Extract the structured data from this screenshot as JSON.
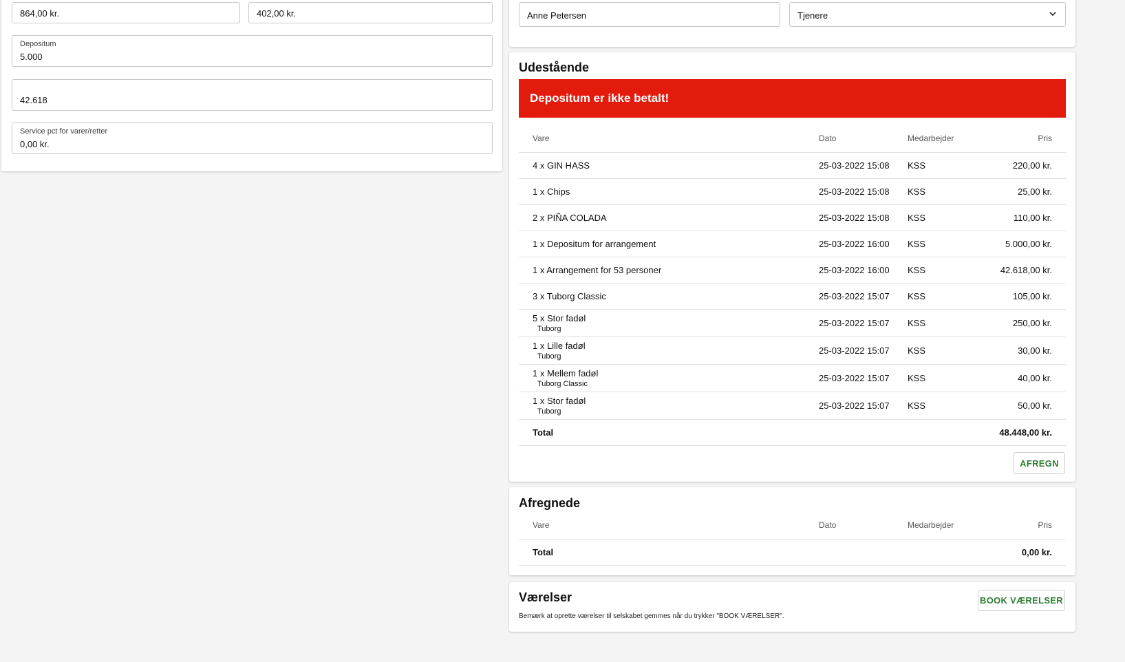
{
  "left_panel": {
    "field_a_value": "864,00 kr.",
    "field_b_value": "402,00 kr.",
    "depositum": {
      "label": "Depositum",
      "value": "5.000"
    },
    "amount_field": {
      "label": "",
      "value": "42.618"
    },
    "service_pct": {
      "label": "Service pct for varer/retter",
      "value": "0,00 kr."
    }
  },
  "top_right": {
    "name_value": "Anne Petersen",
    "role_select": "Tjenere"
  },
  "udestaaende": {
    "title": "Udestående",
    "alert": "Depositum er ikke betalt!",
    "columns": {
      "vare": "Vare",
      "dato": "Dato",
      "medarbejder": "Medarbejder",
      "pris": "Pris"
    },
    "rows": [
      {
        "vare": "4 x GIN HASS",
        "sub": "",
        "dato": "25-03-2022 15:08",
        "medarbejder": "KSS",
        "pris": "220,00 kr."
      },
      {
        "vare": "1 x Chips",
        "sub": "",
        "dato": "25-03-2022 15:08",
        "medarbejder": "KSS",
        "pris": "25,00 kr."
      },
      {
        "vare": "2 x PIÑA COLADA",
        "sub": "",
        "dato": "25-03-2022 15:08",
        "medarbejder": "KSS",
        "pris": "110,00 kr."
      },
      {
        "vare": "1 x Depositum for arrangement",
        "sub": "",
        "dato": "25-03-2022 16:00",
        "medarbejder": "KSS",
        "pris": "5.000,00 kr."
      },
      {
        "vare": "1 x Arrangement for 53 personer",
        "sub": "",
        "dato": "25-03-2022 16:00",
        "medarbejder": "KSS",
        "pris": "42.618,00 kr."
      },
      {
        "vare": "3 x Tuborg Classic",
        "sub": "",
        "dato": "25-03-2022 15:07",
        "medarbejder": "KSS",
        "pris": "105,00 kr."
      },
      {
        "vare": "5 x Stor fadøl",
        "sub": "Tuborg",
        "dato": "25-03-2022 15:07",
        "medarbejder": "KSS",
        "pris": "250,00 kr."
      },
      {
        "vare": "1 x Lille fadøl",
        "sub": "Tuborg",
        "dato": "25-03-2022 15:07",
        "medarbejder": "KSS",
        "pris": "30,00 kr."
      },
      {
        "vare": "1 x Mellem fadøl",
        "sub": "Tuborg Classic",
        "dato": "25-03-2022 15:07",
        "medarbejder": "KSS",
        "pris": "40,00 kr."
      },
      {
        "vare": "1 x Stor fadøl",
        "sub": "Tuborg",
        "dato": "25-03-2022 15:07",
        "medarbejder": "KSS",
        "pris": "50,00 kr."
      }
    ],
    "total_label": "Total",
    "total_value": "48.448,00 kr.",
    "afregn_button": "AFREGN"
  },
  "afregnede": {
    "title": "Afregnede",
    "columns": {
      "vare": "Vare",
      "dato": "Dato",
      "medarbejder": "Medarbejder",
      "pris": "Pris"
    },
    "total_label": "Total",
    "total_value": "0,00 kr."
  },
  "vaerelser": {
    "title": "Værelser",
    "note": "Bemærk at oprette værelser til selskabet gemmes når du trykker \"BOOK VÆRELSER\".",
    "book_button": "BOOK VÆRELSER"
  },
  "colors": {
    "alert_red": "#e31b0c",
    "button_green": "#2e7d32"
  },
  "icons": {
    "select_arrow": "chevron-down-icon"
  }
}
